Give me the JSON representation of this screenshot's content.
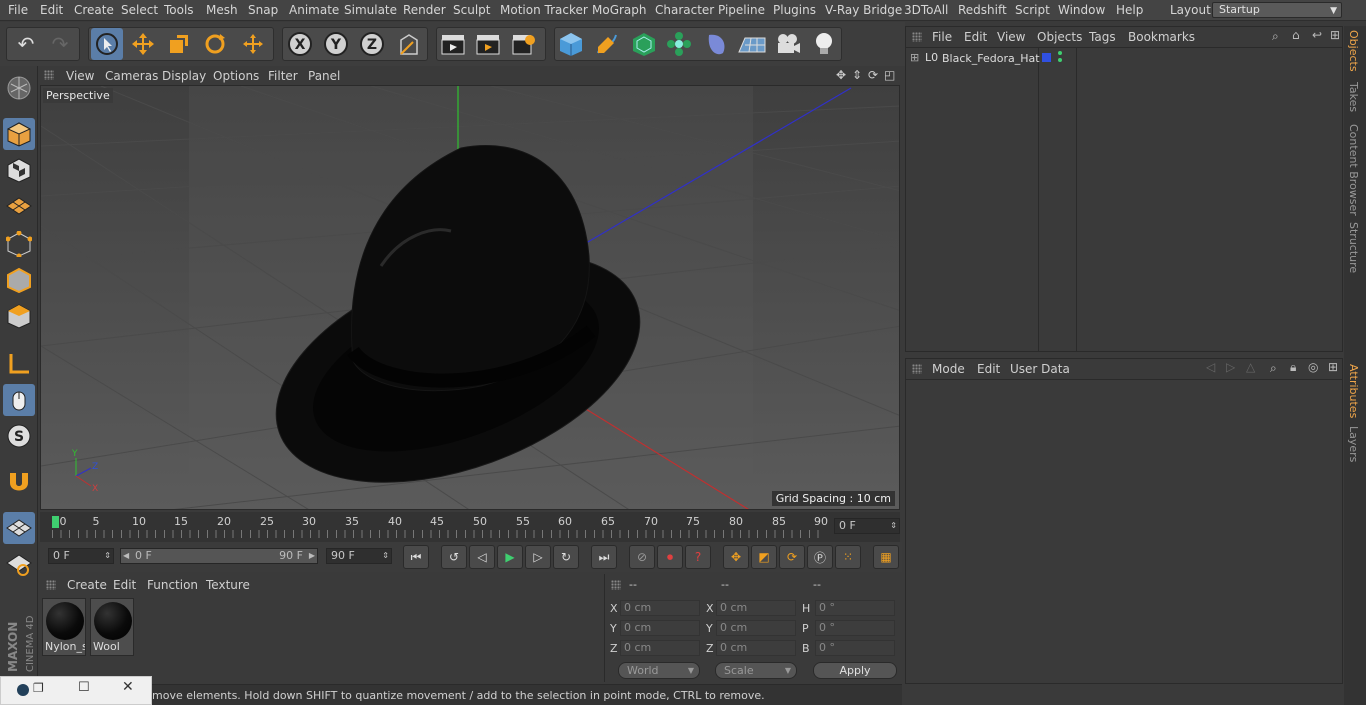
{
  "menu": [
    "File",
    "Edit",
    "Create",
    "Select",
    "Tools",
    "Mesh",
    "Snap",
    "Animate",
    "Simulate",
    "Render",
    "Sculpt",
    "Motion Tracker",
    "MoGraph",
    "Character",
    "Pipeline",
    "Plugins",
    "V-Ray Bridge",
    "3DToAll",
    "Redshift",
    "Script",
    "Window",
    "Help"
  ],
  "layout": {
    "label": "Layout:",
    "value": "Startup"
  },
  "viewport": {
    "menu": [
      "View",
      "Cameras",
      "Display",
      "Options",
      "Filter",
      "Panel"
    ],
    "camera_label": "Perspective",
    "grid_spacing": "Grid Spacing : 10 cm"
  },
  "timeline": {
    "ticks": [
      "0",
      "5",
      "10",
      "15",
      "20",
      "25",
      "30",
      "35",
      "40",
      "45",
      "50",
      "55",
      "60",
      "65",
      "70",
      "75",
      "80",
      "85",
      "90"
    ],
    "current_frame": "0 F"
  },
  "transport": {
    "start_field": "0 F",
    "range_start": "0 F",
    "range_end": "90 F",
    "end_field": "90 F"
  },
  "materials": {
    "menu": [
      "Create",
      "Edit",
      "Function",
      "Texture"
    ],
    "items": [
      {
        "name": "Nylon_s"
      },
      {
        "name": "Wool"
      }
    ]
  },
  "coords": {
    "headers": [
      "--",
      "--",
      "--"
    ],
    "rows": [
      {
        "l1": "X",
        "v1": "0 cm",
        "l2": "X",
        "v2": "0 cm",
        "l3": "H",
        "v3": "0 °"
      },
      {
        "l1": "Y",
        "v1": "0 cm",
        "l2": "Y",
        "v2": "0 cm",
        "l3": "P",
        "v3": "0 °"
      },
      {
        "l1": "Z",
        "v1": "0 cm",
        "l2": "Z",
        "v2": "0 cm",
        "l3": "B",
        "v3": "0 °"
      }
    ],
    "world": "World",
    "scale": "Scale",
    "apply": "Apply"
  },
  "objects": {
    "menu": [
      "File",
      "Edit",
      "View",
      "Objects",
      "Tags",
      "Bookmarks"
    ],
    "items": [
      {
        "name": "Black_Fedora_Hat"
      }
    ]
  },
  "attributes": {
    "menu": [
      "Mode",
      "Edit",
      "User Data"
    ]
  },
  "right_tabs": [
    "Objects",
    "Takes",
    "Content Browser",
    "Structure",
    "Attributes",
    "Layers"
  ],
  "status": "move elements. Hold down SHIFT to quantize movement / add to the selection in point mode, CTRL to remove.",
  "brand": {
    "maker": "MAXON",
    "product": "CINEMA 4D"
  },
  "colors": {
    "accent": "#5b7ea8",
    "x_axis": "#c03030",
    "y_axis": "#30c030",
    "z_axis": "#3030c8",
    "active_tab": "#f0a64a"
  }
}
